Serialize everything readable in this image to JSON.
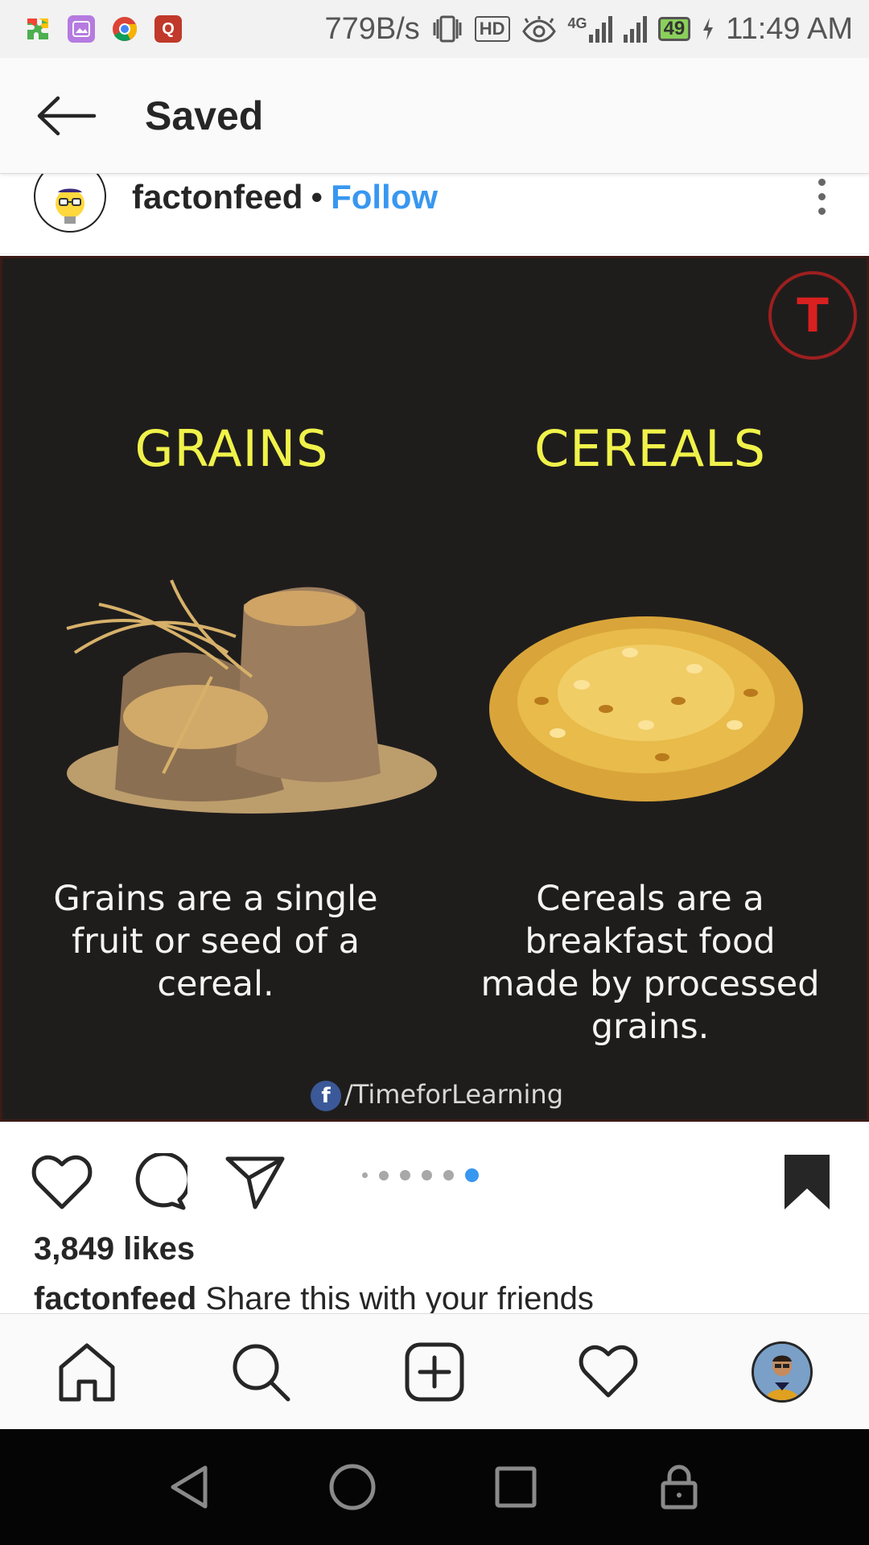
{
  "status_bar": {
    "network_speed": "779B/s",
    "hd_badge": "HD",
    "network_type": "4G",
    "battery": "49",
    "time": "11:49 AM",
    "icons": [
      "puzzle-app-icon",
      "gallery-app-icon",
      "chrome-icon",
      "quora-icon",
      "vibrate-icon",
      "hd-icon",
      "eye-icon",
      "signal-4g-icon",
      "signal-icon",
      "battery-icon",
      "charging-icon"
    ]
  },
  "header": {
    "title": "Saved",
    "back_icon": "arrow-left-icon"
  },
  "post": {
    "username": "factonfeed",
    "separator": "•",
    "follow_label": "Follow",
    "more_icon": "more-vertical-icon",
    "image": {
      "left_heading": "GRAINS",
      "right_heading": "CEREALS",
      "left_text": "Grains are a single fruit or seed of a cereal.",
      "right_text": "Cereals are a breakfast food made by processed grains.",
      "credit_fb": "f",
      "credit": "/TimeforLearning",
      "logo_letter": "T"
    },
    "carousel": {
      "total": 6,
      "active": 6
    },
    "likes": "3,849 likes",
    "caption_user": "factonfeed",
    "caption_text": "Share this with your friends"
  },
  "actions": {
    "icons": [
      "heart-icon",
      "comment-icon",
      "share-icon",
      "bookmark-icon"
    ]
  },
  "bottom_nav": {
    "items": [
      "home-icon",
      "search-icon",
      "add-post-icon",
      "activity-heart-icon",
      "profile-avatar"
    ]
  },
  "system_nav": {
    "items": [
      "back-triangle-icon",
      "home-circle-icon",
      "recents-square-icon",
      "lock-icon"
    ]
  },
  "colors": {
    "follow_blue": "#3897f0",
    "carousel_active": "#3897f0",
    "heading_yellow": "#f0f24a",
    "image_bg": "#1f1d1c"
  }
}
